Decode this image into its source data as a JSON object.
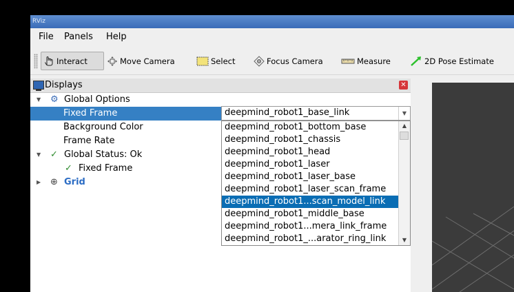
{
  "window": {
    "title": "RViz"
  },
  "menu": {
    "file": "File",
    "panels": "Panels",
    "help": "Help"
  },
  "toolbar": {
    "interact": "Interact",
    "move_camera": "Move Camera",
    "select": "Select",
    "focus_camera": "Focus Camera",
    "measure": "Measure",
    "pose_estimate": "2D Pose Estimate"
  },
  "displays": {
    "title": "Displays",
    "tree": {
      "global_options": "Global Options",
      "fixed_frame": "Fixed Frame",
      "background_color": "Background Color",
      "frame_rate": "Frame Rate",
      "global_status": "Global Status: Ok",
      "status_fixed_frame": "Fixed Frame",
      "grid": "Grid"
    },
    "fixed_frame_value": "deepmind_robot1_base_link",
    "options": [
      "deepmind_robot1_bottom_base",
      "deepmind_robot1_chassis",
      "deepmind_robot1_head",
      "deepmind_robot1_laser",
      "deepmind_robot1_laser_base",
      "deepmind_robot1_laser_scan_frame",
      "deepmind_robot1...scan_model_link",
      "deepmind_robot1_middle_base",
      "deepmind_robot1...mera_link_frame",
      "deepmind_robot1_...arator_ring_link"
    ],
    "selected_option": "deepmind_robot1...scan_model_link"
  },
  "colors": {
    "accent": "#3580c4",
    "highlight": "#0a6db4",
    "viewport": "#3b3b3b"
  }
}
